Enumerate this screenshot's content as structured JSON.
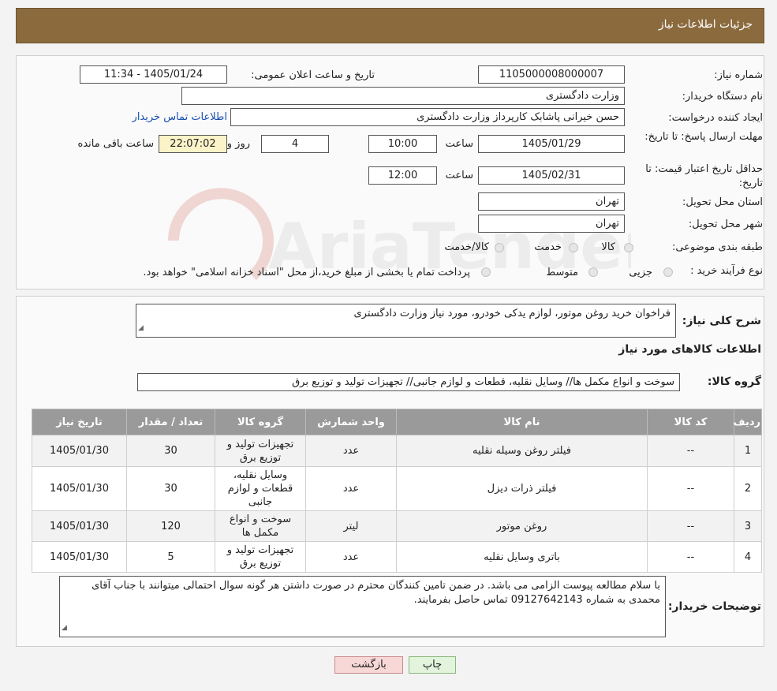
{
  "header": {
    "title": "جزئیات اطلاعات نیاز"
  },
  "form": {
    "need_number": {
      "label": "شماره نیاز:",
      "value": "1105000008000007"
    },
    "announce": {
      "label": "تاریخ و ساعت اعلان عمومی:",
      "value": "1405/01/24 - 11:34"
    },
    "buyer_org": {
      "label": "نام دستگاه خریدار:",
      "value": "وزارت دادگستری"
    },
    "creator": {
      "label": "ایجاد کننده درخواست:",
      "value": "حسن خیرانی پاشابک کارپرداز وزارت دادگستری",
      "contact_link": "اطلاعات تماس خریدار"
    },
    "deadline": {
      "label": "مهلت ارسال پاسخ: تا تاریخ:",
      "date": "1405/01/29",
      "time_label": "ساعت",
      "time": "10:00",
      "days": "4",
      "days_label": "روز و",
      "remaining": "22:07:02",
      "remaining_label": "ساعت باقی مانده"
    },
    "validity": {
      "label": "حداقل تاریخ اعتبار قیمت: تا تاریخ:",
      "date": "1405/02/31",
      "time_label": "ساعت",
      "time": "12:00"
    },
    "province": {
      "label": "استان محل تحویل:",
      "value": "تهران"
    },
    "city": {
      "label": "شهر محل تحویل:",
      "value": "تهران"
    },
    "category": {
      "label": "طبقه بندی موضوعی:",
      "options": [
        "کالا",
        "خدمت",
        "کالا/خدمت"
      ]
    },
    "process": {
      "label": "نوع فرآیند خرید :",
      "options": [
        "جزیی",
        "متوسط"
      ],
      "note": "پرداخت تمام یا بخشی از مبلغ خرید،از محل \"اسناد خزانه اسلامی\" خواهد بود."
    }
  },
  "description": {
    "label": "شرح کلی نیاز:",
    "value": "فراخوان خرید روغن موتور، لوازم یدکی خودرو، مورد نیاز وزارت دادگستری"
  },
  "goods_info": {
    "title": "اطلاعات کالاهای مورد نیاز"
  },
  "goods_group": {
    "label": "گروه کالا:",
    "value": "سوخت و انواع مکمل ها// وسایل نقلیه، قطعات و لوازم جانبی// تجهیزات تولید و توزیع برق"
  },
  "table": {
    "headers": [
      "ردیف",
      "کد کالا",
      "نام کالا",
      "واحد شمارش",
      "گروه کالا",
      "تعداد / مقدار",
      "تاریخ نیاز"
    ],
    "rows": [
      [
        "1",
        "--",
        "فیلتر روغن وسیله نقلیه",
        "عدد",
        "تجهیزات تولید و توزیع برق",
        "30",
        "1405/01/30"
      ],
      [
        "2",
        "--",
        "فیلتر ذرات دیزل",
        "عدد",
        "وسایل نقلیه، قطعات و لوازم جانبی",
        "30",
        "1405/01/30"
      ],
      [
        "3",
        "--",
        "روغن موتور",
        "لیتر",
        "سوخت و انواع مکمل ها",
        "120",
        "1405/01/30"
      ],
      [
        "4",
        "--",
        "باتری وسایل نقلیه",
        "عدد",
        "تجهیزات تولید و توزیع برق",
        "5",
        "1405/01/30"
      ]
    ]
  },
  "buyer_notes": {
    "label": "توضیحات خریدار:",
    "value": "با سلام مطالعه پیوست الزامی می باشد. در ضمن تامین کنندگان محترم در صورت داشتن هر گونه سوال احتمالی میتوانند با جناب آقای محمدی به شماره 09127642143 تماس حاصل بفرمایند."
  },
  "buttons": {
    "print": "چاپ",
    "back": "بازگشت"
  },
  "watermark": {
    "text": "AriaTender.neT"
  },
  "colors": {
    "header_bg": "#8b6b3e",
    "back_btn": "#f8d7d7",
    "print_btn": "#e2f5dc",
    "link": "#1a4fb0"
  }
}
